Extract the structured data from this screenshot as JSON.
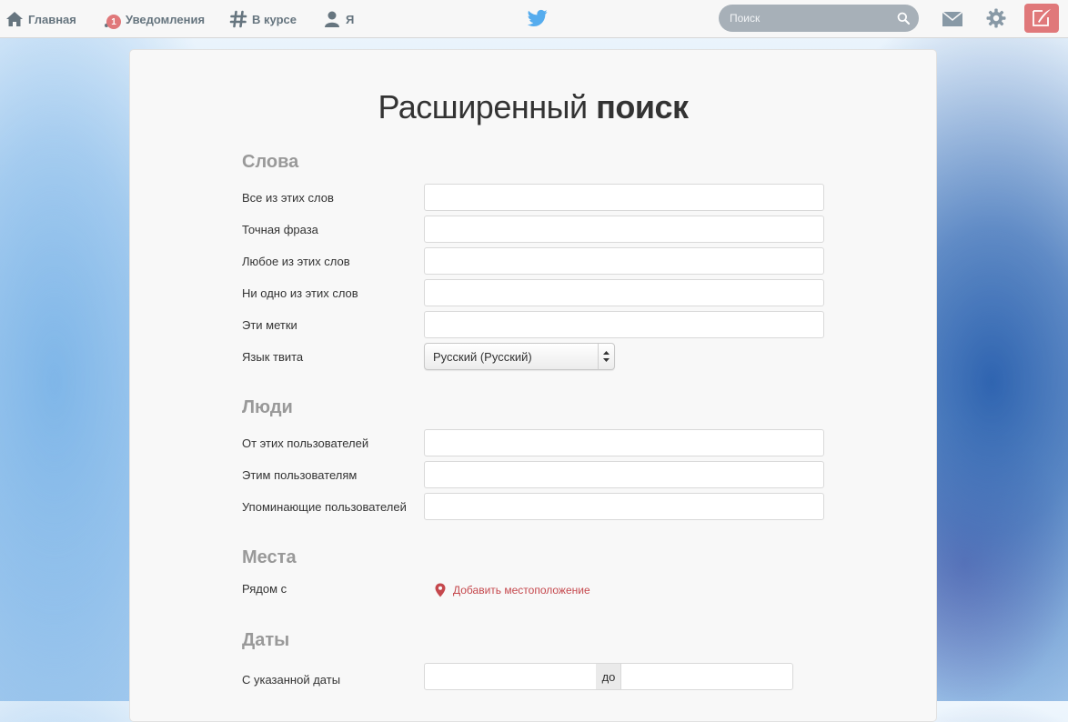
{
  "topbar": {
    "nav": [
      {
        "label": "Главная",
        "icon": "home-icon"
      },
      {
        "label": "Уведомления",
        "icon": "notifications-icon",
        "badge": "1"
      },
      {
        "label": "В курсе",
        "icon": "hashtag-icon"
      },
      {
        "label": "Я",
        "icon": "user-icon"
      }
    ],
    "search_placeholder": "Поиск",
    "colors": {
      "nav_text": "#66757f",
      "badge": "#e0787a",
      "twitter_blue": "#55acee",
      "search_bg": "#a7b0b8",
      "compose_bg": "#e0787a"
    }
  },
  "page": {
    "title_light": "Расширенный",
    "title_bold": "поиск"
  },
  "sections": {
    "words": {
      "title": "Слова",
      "fields": [
        {
          "label": "Все из этих слов",
          "value": ""
        },
        {
          "label": "Точная фраза",
          "value": ""
        },
        {
          "label": "Любое из этих слов",
          "value": ""
        },
        {
          "label": "Ни одно из этих слов",
          "value": ""
        },
        {
          "label": "Эти метки",
          "value": ""
        }
      ],
      "language_label": "Язык твита",
      "language_value": "Русский (Русский)"
    },
    "people": {
      "title": "Люди",
      "fields": [
        {
          "label": "От этих пользователей",
          "value": ""
        },
        {
          "label": "Этим пользователям",
          "value": ""
        },
        {
          "label": "Упоминающие пользователей",
          "value": ""
        }
      ]
    },
    "places": {
      "title": "Места",
      "near_label": "Рядом с",
      "add_location": "Добавить местоположение",
      "link_color": "#c5484d"
    },
    "dates": {
      "title": "Даты",
      "since_label": "С указанной даты",
      "to_label": "до",
      "from_value": "",
      "to_value": ""
    }
  }
}
